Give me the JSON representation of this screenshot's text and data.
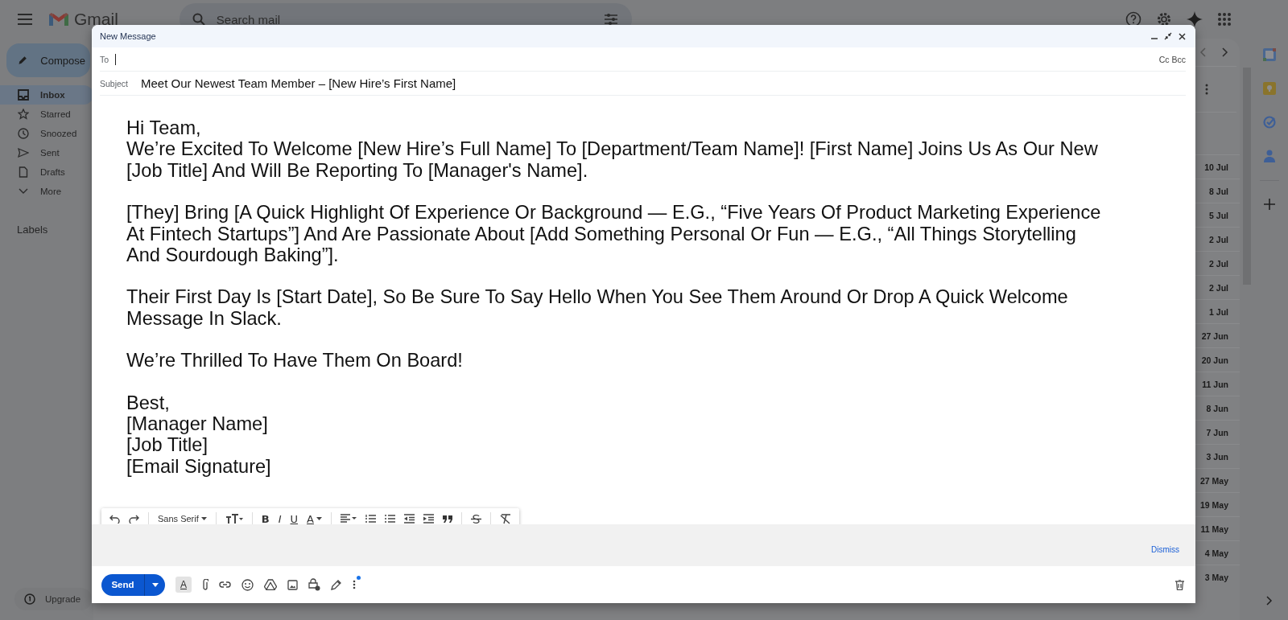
{
  "app": {
    "name": "Gmail",
    "search": {
      "placeholder": "Search mail"
    }
  },
  "sidebar": {
    "compose": "Compose",
    "items": [
      {
        "label": "Inbox",
        "selected": true
      },
      {
        "label": "Starred",
        "selected": false
      },
      {
        "label": "Snoozed",
        "selected": false
      },
      {
        "label": "Sent",
        "selected": false
      },
      {
        "label": "Drafts",
        "selected": false
      },
      {
        "label": "More",
        "selected": false
      }
    ],
    "labels_heading": "Labels",
    "upgrade": "Upgrade"
  },
  "mail_list": {
    "dates": [
      "10 Jul",
      "8 Jul",
      "5 Jul",
      "2 Jul",
      "2 Jul",
      "2 Jul",
      "1 Jul",
      "27 Jun",
      "20 Jun",
      "11 Jun",
      "8 Jun",
      "7 Jun",
      "3 Jun",
      "27 May",
      "19 May",
      "11 May",
      "4 May",
      "3 May"
    ]
  },
  "compose": {
    "title": "New Message",
    "to": {
      "label": "To"
    },
    "cc_bcc": "Cc Bcc",
    "subject": {
      "label": "Subject",
      "value": "Meet Our Newest Team Member – [New Hire’s First Name]"
    },
    "body": [
      [
        "Hi Team,",
        "We’re Excited To Welcome [New Hire’s Full Name] To [Department/Team Name]! [First Name] Joins Us As Our New [Job Title] And Will Be Reporting To [Manager's Name]."
      ],
      [
        "[They] Bring [A Quick Highlight Of Experience Or Background — E.G., “Five Years Of Product Marketing Experience At Fintech Startups”] And Are Passionate About [Add Something Personal Or Fun — E.G., “All Things Storytelling And Sourdough Baking”]."
      ],
      [
        "Their First Day Is [Start Date], So Be Sure To Say Hello When You See Them Around Or Drop A Quick Welcome Message In Slack."
      ],
      [
        "We’re Thrilled To Have Them On Board!"
      ],
      [
        "Best,",
        "[Manager Name]",
        "[Job Title]",
        "[Email Signature]"
      ]
    ],
    "toolbar": {
      "font": "Sans Serif",
      "bold": "B",
      "italic": "I",
      "underline": "U",
      "text_color": "A"
    },
    "notice": {
      "dismiss": "Dismiss"
    },
    "send": "Send",
    "formatting": {
      "glyph": "A",
      "selected": true
    },
    "more_options_badge": true
  }
}
